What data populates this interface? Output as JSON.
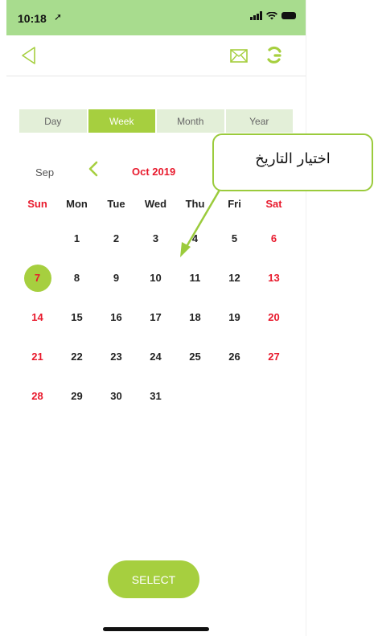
{
  "status_bar": {
    "time": "10:18",
    "location_arrow": "➚"
  },
  "nav": {
    "back_icon": "back-triangle-icon",
    "mail_icon": "mail-icon",
    "refresh_icon": "refresh-icon"
  },
  "segments": [
    {
      "label": "Day",
      "active": false
    },
    {
      "label": "Week",
      "active": true
    },
    {
      "label": "Month",
      "active": false
    },
    {
      "label": "Year",
      "active": false
    }
  ],
  "month_nav": {
    "prev_month": "Sep",
    "current_month": "Oct 2019"
  },
  "weekdays": [
    "Sun",
    "Mon",
    "Tue",
    "Wed",
    "Thu",
    "Fri",
    "Sat"
  ],
  "calendar": {
    "selected_day": "7",
    "weeks": [
      [
        "",
        "1",
        "2",
        "3",
        "4",
        "5",
        "6"
      ],
      [
        "7",
        "8",
        "9",
        "10",
        "11",
        "12",
        "13"
      ],
      [
        "14",
        "15",
        "16",
        "17",
        "18",
        "19",
        "20"
      ],
      [
        "21",
        "22",
        "23",
        "24",
        "25",
        "26",
        "27"
      ],
      [
        "28",
        "29",
        "30",
        "31",
        "",
        "",
        ""
      ]
    ]
  },
  "select_button": "SELECT",
  "annotation": {
    "text": "اختيار التاريخ"
  },
  "colors": {
    "accent": "#a6cf3f",
    "weekend": "#e8192c",
    "status_bar": "#a8dc8e"
  }
}
